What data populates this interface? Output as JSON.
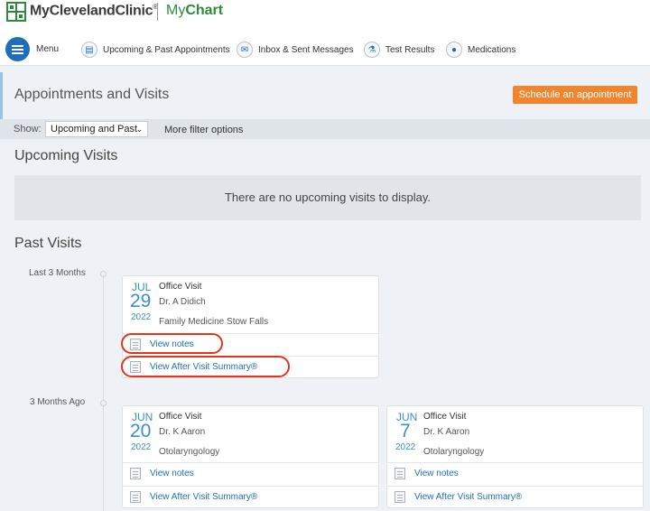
{
  "brand": {
    "name": "MyClevelandClinic",
    "registered": "®",
    "product_prefix": "My",
    "product_name": "Chart"
  },
  "nav": {
    "menu_label": "Menu",
    "items": [
      {
        "label": "Upcoming & Past Appointments",
        "icon": "calendar-icon"
      },
      {
        "label": "Inbox & Sent Messages",
        "icon": "envelope-icon"
      },
      {
        "label": "Test Results",
        "icon": "flask-icon"
      },
      {
        "label": "Medications",
        "icon": "pills-icon"
      }
    ]
  },
  "page": {
    "title": "Appointments and Visits",
    "schedule_label": "Schedule an appointment"
  },
  "filter": {
    "show_label": "Show:",
    "selected": "Upcoming and Past",
    "more_label": "More filter options"
  },
  "upcoming": {
    "title": "Upcoming Visits",
    "empty_text": "There are no upcoming visits to display."
  },
  "past": {
    "title": "Past Visits",
    "groups": [
      {
        "label": "Last 3 Months",
        "visits": [
          {
            "month": "JUL",
            "day": "29",
            "year": "2022",
            "type": "Office Visit",
            "doctor": "Dr. A Didich",
            "department": "Family Medicine Stow Falls",
            "notes_label": "View notes",
            "summary_label": "View After Visit Summary®"
          }
        ]
      },
      {
        "label": "3 Months Ago",
        "visits": [
          {
            "month": "JUN",
            "day": "20",
            "year": "2022",
            "type": "Office Visit",
            "doctor": "Dr. K Aaron",
            "department": "Otolaryngology",
            "notes_label": "View notes",
            "summary_label": "View After Visit Summary®"
          },
          {
            "month": "JUN",
            "day": "7",
            "year": "2022",
            "type": "Office Visit",
            "doctor": "Dr. K Aaron",
            "department": "Otolaryngology",
            "notes_label": "View notes",
            "summary_label": "View After Visit Summary®"
          }
        ]
      }
    ]
  },
  "colors": {
    "accent": "#1f6fb8",
    "date_blue": "#3b8fd0",
    "schedule_orange": "#f0852d",
    "brand_green": "#2e8b3e",
    "highlight_red": "#e0371a"
  }
}
